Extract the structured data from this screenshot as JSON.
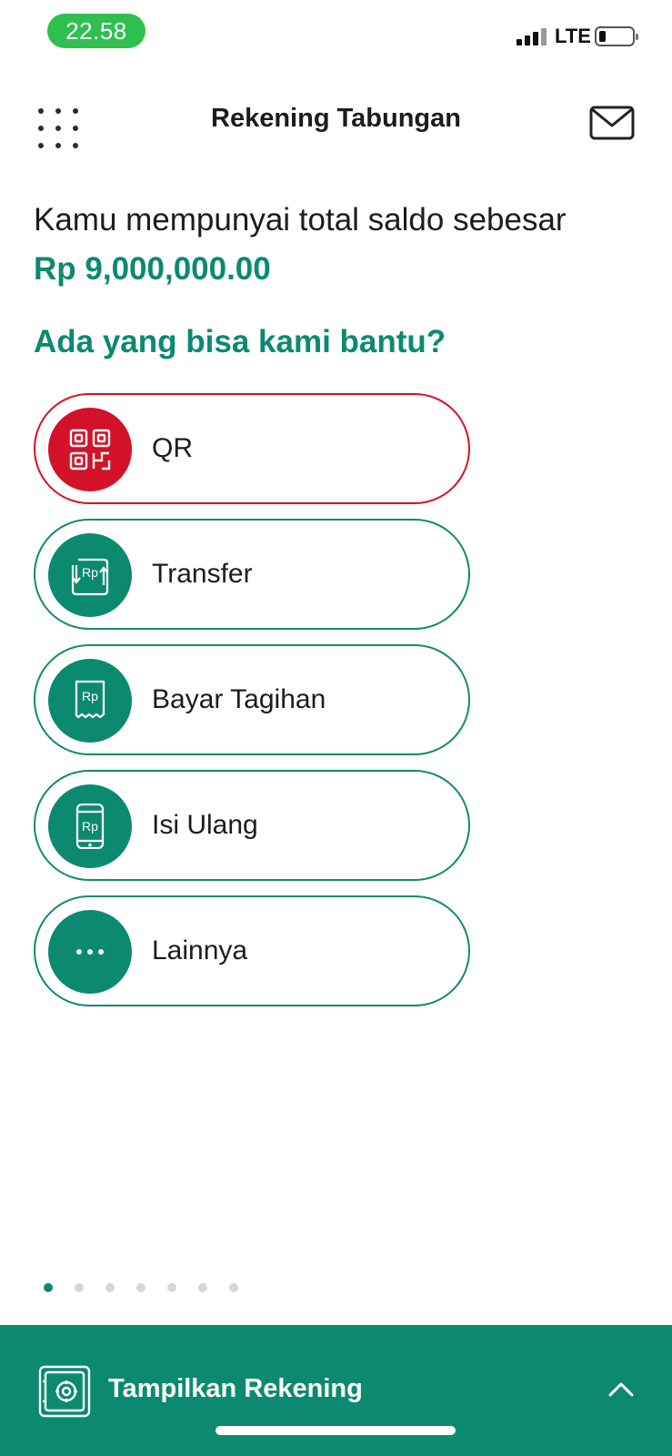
{
  "status_bar": {
    "time": "22.58",
    "network": "LTE"
  },
  "header": {
    "title": "Rekening Tabungan"
  },
  "balance": {
    "intro": "Kamu mempunyai total saldo sebesar",
    "amount": "Rp 9,000,000.00"
  },
  "help_title": "Ada yang bisa kami bantu?",
  "actions": [
    {
      "label": "QR",
      "icon": "qr-code-icon"
    },
    {
      "label": "Transfer",
      "icon": "transfer-icon"
    },
    {
      "label": "Bayar Tagihan",
      "icon": "bill-receipt-icon"
    },
    {
      "label": "Isi Ulang",
      "icon": "phone-topup-icon"
    },
    {
      "label": "Lainnya",
      "icon": "more-dots-icon"
    }
  ],
  "pager": {
    "total": 7,
    "active_index": 0
  },
  "bottom_bar": {
    "label": "Tampilkan Rekening",
    "icon": "safe-icon"
  },
  "colors": {
    "primary_green": "#0b8a70",
    "qr_red": "#d3122a",
    "time_pill_green": "#2fbf4f"
  }
}
